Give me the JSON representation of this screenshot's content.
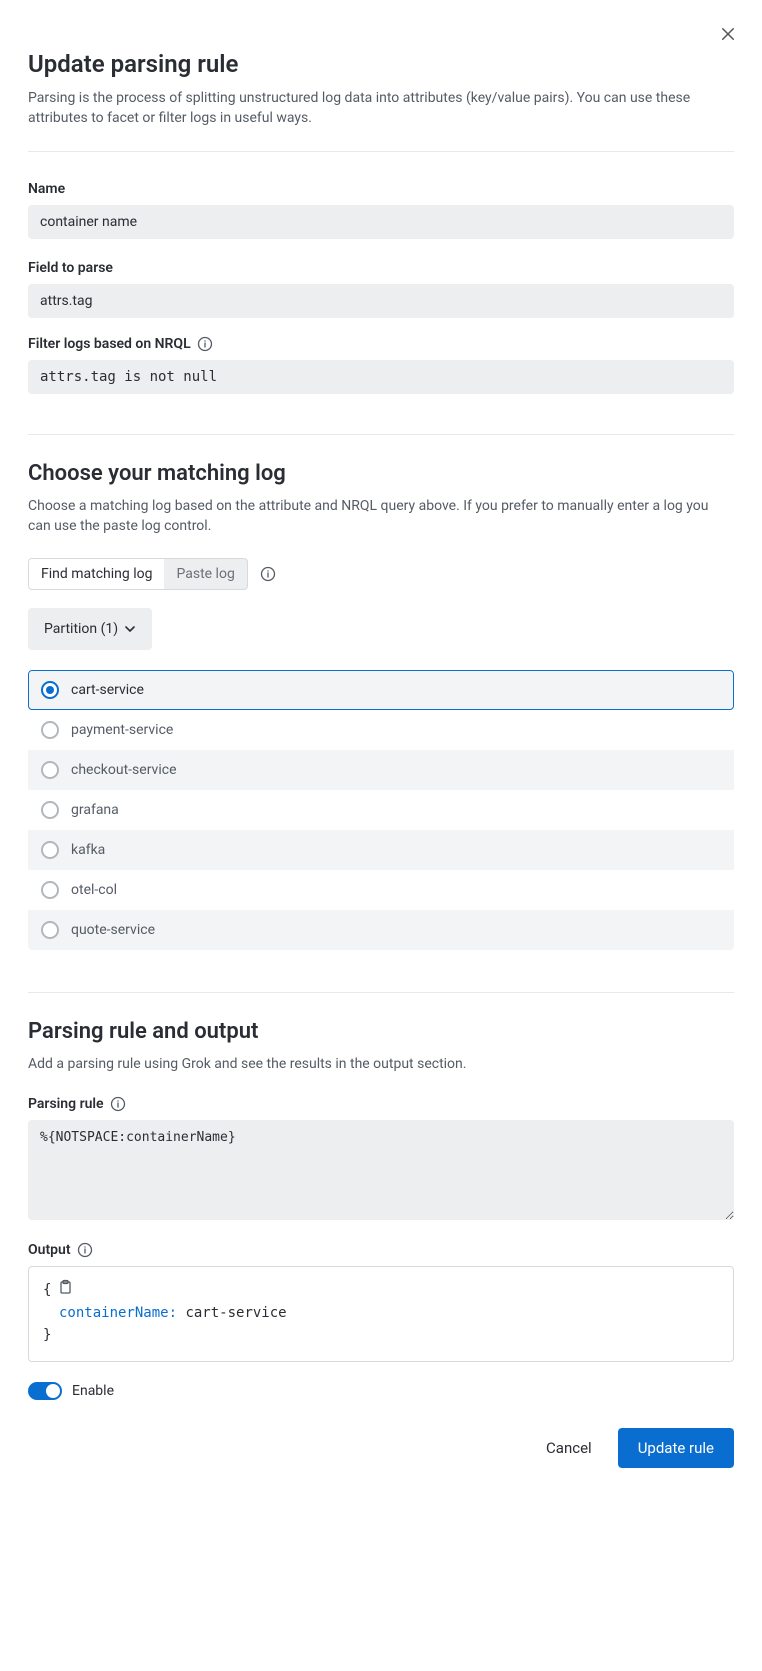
{
  "header": {
    "title": "Update parsing rule",
    "description": "Parsing is the process of splitting unstructured log data into attributes (key/value pairs). You can use these attributes to facet or filter logs in useful ways."
  },
  "fields": {
    "name": {
      "label": "Name",
      "value": "container name"
    },
    "field_to_parse": {
      "label": "Field to parse",
      "value": "attrs.tag"
    },
    "nrql_filter": {
      "label": "Filter logs based on NRQL",
      "value": "attrs.tag is not null"
    }
  },
  "matching_log": {
    "title": "Choose your matching log",
    "description": "Choose a matching log based on the attribute and NRQL query above. If you prefer to manually enter a log you can use the paste log control.",
    "segmented": {
      "find": "Find matching log",
      "paste": "Paste log",
      "active": "find"
    },
    "partition_label": "Partition (1)",
    "items": [
      {
        "label": "cart-service",
        "selected": true
      },
      {
        "label": "payment-service",
        "selected": false
      },
      {
        "label": "checkout-service",
        "selected": false
      },
      {
        "label": "grafana",
        "selected": false
      },
      {
        "label": "kafka",
        "selected": false
      },
      {
        "label": "otel-col",
        "selected": false
      },
      {
        "label": "quote-service",
        "selected": false
      }
    ]
  },
  "parsing": {
    "title": "Parsing rule and output",
    "description": "Add a parsing rule using Grok and see the results in the output section.",
    "rule_label": "Parsing rule",
    "rule_value": "%{NOTSPACE:containerName}",
    "output_label": "Output",
    "output_key": "containerName:",
    "output_value": "cart-service"
  },
  "enable": {
    "label": "Enable",
    "on": true
  },
  "buttons": {
    "cancel": "Cancel",
    "submit": "Update rule"
  }
}
